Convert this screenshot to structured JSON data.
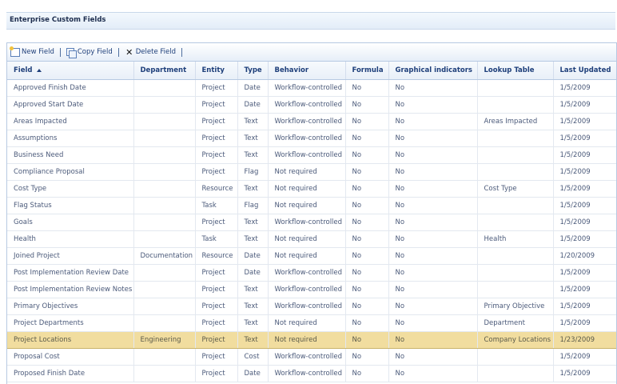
{
  "page": {
    "title": "Enterprise Custom Fields"
  },
  "toolbar": {
    "new_field": "New Field",
    "copy_field": "Copy Field",
    "delete_field": "Delete Field"
  },
  "columns": [
    "Field",
    "Department",
    "Entity",
    "Type",
    "Behavior",
    "Formula",
    "Graphical indicators",
    "Lookup Table",
    "Last Updated"
  ],
  "rows": [
    [
      "Approved Finish Date",
      "",
      "Project",
      "Date",
      "Workflow-controlled",
      "No",
      "No",
      "",
      "1/5/2009"
    ],
    [
      "Approved Start Date",
      "",
      "Project",
      "Date",
      "Workflow-controlled",
      "No",
      "No",
      "",
      "1/5/2009"
    ],
    [
      "Areas Impacted",
      "",
      "Project",
      "Text",
      "Workflow-controlled",
      "No",
      "No",
      "Areas Impacted",
      "1/5/2009"
    ],
    [
      "Assumptions",
      "",
      "Project",
      "Text",
      "Workflow-controlled",
      "No",
      "No",
      "",
      "1/5/2009"
    ],
    [
      "Business Need",
      "",
      "Project",
      "Text",
      "Workflow-controlled",
      "No",
      "No",
      "",
      "1/5/2009"
    ],
    [
      "Compliance Proposal",
      "",
      "Project",
      "Flag",
      "Not required",
      "No",
      "No",
      "",
      "1/5/2009"
    ],
    [
      "Cost Type",
      "",
      "Resource",
      "Text",
      "Not required",
      "No",
      "No",
      "Cost Type",
      "1/5/2009"
    ],
    [
      "Flag Status",
      "",
      "Task",
      "Flag",
      "Not required",
      "No",
      "No",
      "",
      "1/5/2009"
    ],
    [
      "Goals",
      "",
      "Project",
      "Text",
      "Workflow-controlled",
      "No",
      "No",
      "",
      "1/5/2009"
    ],
    [
      "Health",
      "",
      "Task",
      "Text",
      "Not required",
      "No",
      "No",
      "Health",
      "1/5/2009"
    ],
    [
      "Joined Project",
      "Documentation",
      "Resource",
      "Date",
      "Not required",
      "No",
      "No",
      "",
      "1/20/2009"
    ],
    [
      "Post Implementation Review Date",
      "",
      "Project",
      "Date",
      "Workflow-controlled",
      "No",
      "No",
      "",
      "1/5/2009"
    ],
    [
      "Post Implementation Review Notes",
      "",
      "Project",
      "Text",
      "Workflow-controlled",
      "No",
      "No",
      "",
      "1/5/2009"
    ],
    [
      "Primary Objectives",
      "",
      "Project",
      "Text",
      "Workflow-controlled",
      "No",
      "No",
      "Primary Objective",
      "1/5/2009"
    ],
    [
      "Project Departments",
      "",
      "Project",
      "Text",
      "Not required",
      "No",
      "No",
      "Department",
      "1/5/2009"
    ],
    [
      "Project Locations",
      "Engineering",
      "Project",
      "Text",
      "Not required",
      "No",
      "No",
      "Company Locations",
      "1/23/2009"
    ],
    [
      "Proposal Cost",
      "",
      "Project",
      "Cost",
      "Workflow-controlled",
      "No",
      "No",
      "",
      "1/5/2009"
    ],
    [
      "Proposed Finish Date",
      "",
      "Project",
      "Date",
      "Workflow-controlled",
      "No",
      "No",
      "",
      "1/5/2009"
    ]
  ],
  "selected_row": 15
}
